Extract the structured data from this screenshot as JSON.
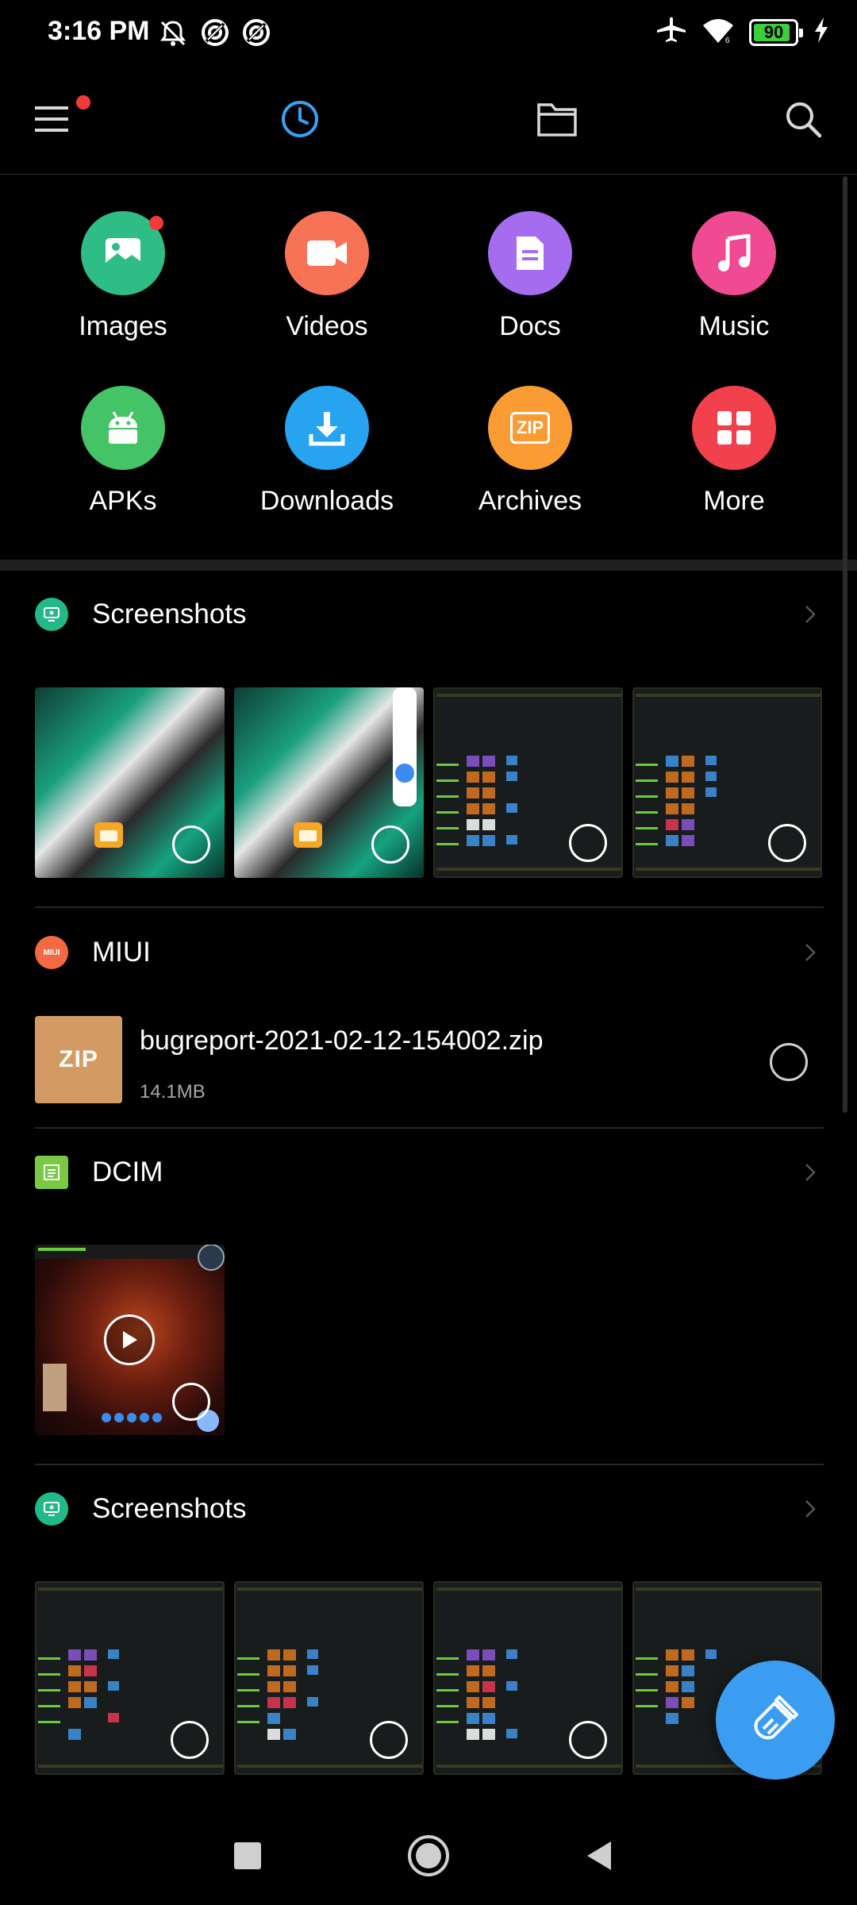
{
  "status_bar": {
    "time": "3:16 PM",
    "left_icons": [
      "mute-icon",
      "sync-icon",
      "sync-icon"
    ],
    "right_icons": [
      "airplane-icon",
      "wifi-icon",
      "battery-icon",
      "charging-icon"
    ],
    "battery": "90"
  },
  "toolbar": {
    "icons": [
      "menu-icon",
      "recent-clock-icon",
      "folder-icon",
      "search-icon"
    ],
    "accent": "#3aa0f5",
    "notification_dot": "#f23a3a"
  },
  "categories": [
    {
      "label": "Images",
      "icon": "image-icon",
      "color": "#2fbd86",
      "dot": true
    },
    {
      "label": "Videos",
      "icon": "video-icon",
      "color": "#f87356",
      "dot": false
    },
    {
      "label": "Docs",
      "icon": "document-icon",
      "color": "#a66cf0",
      "dot": false
    },
    {
      "label": "Music",
      "icon": "music-note-icon",
      "color": "#f04a93",
      "dot": false
    },
    {
      "label": "APKs",
      "icon": "android-icon",
      "color": "#44c466",
      "dot": false
    },
    {
      "label": "Downloads",
      "icon": "download-icon",
      "color": "#26a4f0",
      "dot": false
    },
    {
      "label": "Archives",
      "icon": "zip-icon",
      "color": "#fb9b33",
      "dot": false,
      "icon_text": "ZIP"
    },
    {
      "label": "More",
      "icon": "grid-icon",
      "color": "#f2404d",
      "dot": false
    }
  ],
  "sections": {
    "screenshots_1": {
      "title": "Screenshots",
      "icon": "screenshot-icon",
      "color": "#22b98a"
    },
    "miui": {
      "title": "MIUI",
      "icon": "miui-icon",
      "color": "#f26a44",
      "icon_text": "MIUI"
    },
    "dcim": {
      "title": "DCIM",
      "icon": "dcim-icon",
      "color": "#7ac943"
    },
    "screenshots_2": {
      "title": "Screenshots",
      "icon": "screenshot-icon",
      "color": "#22b98a"
    }
  },
  "file": {
    "name": "bugreport-2021-02-12-154002.zip",
    "size": "14.1MB",
    "tile_text": "ZIP"
  },
  "fab": {
    "icon": "broom-clean-icon",
    "color": "#3a9df2"
  },
  "navbar": {
    "icons": [
      "recents-square-icon",
      "home-circle-icon",
      "back-triangle-icon"
    ]
  }
}
